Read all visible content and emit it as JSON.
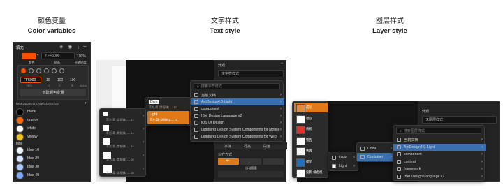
{
  "sections": {
    "color": {
      "cn": "颜色变量",
      "en": "Color variables"
    },
    "text": {
      "cn": "文字样式",
      "en": "Text style"
    },
    "layer": {
      "cn": "图层样式",
      "en": "Layer style"
    }
  },
  "color_panel": {
    "title": "填充",
    "hex_value": "FF5000",
    "hex_prefix": "#",
    "opacity": "100%",
    "tabs": [
      "颜色",
      "Web",
      "不透明度"
    ],
    "picker_hex": "FF5000",
    "picker_nums": [
      "19",
      "100",
      "100"
    ],
    "picker_labels": [
      "HEX",
      "H",
      "S",
      "B",
      "Alpha"
    ],
    "create_button": "创建颜色变量",
    "library": "IBM DESIGN LANGUAGE V2",
    "items": [
      {
        "label": "black",
        "color": "#000000"
      },
      {
        "label": "orange",
        "color": "#ff6a00"
      },
      {
        "label": "white",
        "color": "#ffffff"
      },
      {
        "label": "yellow",
        "color": "#f1c21b"
      }
    ],
    "group": "blue",
    "blue_items": [
      {
        "label": "blue 10",
        "color": "#edf5ff"
      },
      {
        "label": "blue 20",
        "color": "#d0e2ff"
      },
      {
        "label": "blue 30",
        "color": "#a6c8ff"
      },
      {
        "label": "blue 40",
        "color": "#78a9ff"
      }
    ],
    "accent": "#ff5000"
  },
  "text_style": {
    "panel_title": "外观",
    "style_select": "无字符样式",
    "search_placeholder": "搜索字符样式",
    "libraries": [
      "当前文档",
      "AntDesign4.0-Light",
      "component",
      "IBM Design Language v2",
      "iOS UI Design",
      "Lightning Design System Components for Mobile",
      "Lightning Design System Components for Web"
    ],
    "dark_item": {
      "title": "Dark",
      "sub": "苹方-简 (常规体) — 12"
    },
    "light_item": {
      "title": "Light",
      "sub": "苹方-简 (常规体) — 12"
    },
    "sizes": [
      {
        "sub": "苹方-简 (常规体) — 12"
      },
      {
        "sub": "苹方-简 (常规体) — 14"
      },
      {
        "sub": "苹方-简 (常规体) — 16"
      },
      {
        "sub": "苹方-简 (常规体) — 20"
      },
      {
        "sub": "苹方-简 (常规体) — 24"
      }
    ],
    "tabs": [
      "字体",
      "行高",
      "段落"
    ],
    "align_label": "对齐方式",
    "auto_height": "自动宽度",
    "accent": "#e07a18"
  },
  "layer_style": {
    "panel_title": "外观",
    "style_select": "无图层样式",
    "search_placeholder": "搜索图层样式",
    "libraries": [
      "当前文档",
      "AntDesign4.0-Light",
      "component",
      "content",
      "framework",
      "IBM Design Language v2"
    ],
    "color_menu": [
      "Color",
      "Container"
    ],
    "dark_light": [
      "Dark",
      "Light"
    ],
    "swatches": [
      {
        "label": "成功",
        "color": "#e58c3a"
      },
      {
        "label": "错误",
        "color": "#ffffff"
      },
      {
        "label": "商机",
        "color": "#e0332e"
      },
      {
        "label": "警告",
        "color": "#ffffff"
      },
      {
        "label": "失败",
        "color": "#f3f3f3"
      },
      {
        "label": "提示",
        "color": "#1f70c1"
      },
      {
        "label": "投影-概念规",
        "color": "#ffffff"
      }
    ]
  }
}
